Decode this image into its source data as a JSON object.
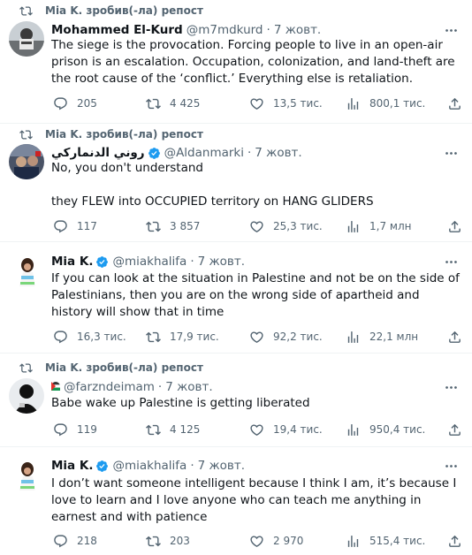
{
  "tweets": [
    {
      "repost": "Mia K. зробив(-ла) репост",
      "name": "Mohammed El-Kurd",
      "verified": false,
      "handle": "@m7mdkurd",
      "dot": "·",
      "date": "7 жовт.",
      "text": "The siege is the provocation. Forcing people to live in an open-air prison is an escalation. Occupation, colonization, and land-theft are the root cause of the ‘conflict.’ Everything else is retaliation.",
      "replies": "205",
      "reposts": "4 425",
      "likes": "13,5 тис.",
      "views": "800,1 тис."
    },
    {
      "repost": "Mia K. зробив(-ла) репост",
      "name": "روني الدنماركي",
      "verified": true,
      "handle": "@Aldanmarki",
      "dot": "·",
      "date": "7 жовт.",
      "text": "No, you don't understand\n\nthey FLEW into OCCUPIED territory on HANG GLIDERS",
      "replies": "117",
      "reposts": "3 857",
      "likes": "25,3 тис.",
      "views": "1,7 млн"
    },
    {
      "name": "Mia K.",
      "verified": true,
      "handle": "@miakhalifa",
      "dot": "·",
      "date": "7 жовт.",
      "text": "If you can look at the situation in Palestine and not be on the side of Palestinians, then you are on the wrong side of apartheid and history will show that in time",
      "replies": "16,3 тис.",
      "reposts": "17,9 тис.",
      "likes": "92,2 тис.",
      "views": "22,1 млн"
    },
    {
      "repost": "Mia K. зробив(-ла) репост",
      "name": "",
      "verified": false,
      "handle": "@farzndeimam",
      "dot": "·",
      "date": "7 жовт.",
      "text": "Babe wake up Palestine is getting liberated",
      "replies": "119",
      "reposts": "4 125",
      "likes": "19,4 тис.",
      "views": "950,4 тис."
    },
    {
      "name": "Mia K.",
      "verified": true,
      "handle": "@miakhalifa",
      "dot": "·",
      "date": "7 жовт.",
      "text": "I don’t want someone intelligent because I think I am, it’s because I love to learn and I love anyone who can teach me anything in earnest and with patience",
      "replies": "218",
      "reposts": "203",
      "likes": "2 970",
      "views": "515,4 тис."
    }
  ],
  "colors": {
    "text": "#0f1419",
    "muted": "#536471",
    "verified": "#1d9bf0",
    "divider": "#eff3f4"
  },
  "icons": [
    "repost-icon",
    "reply-icon",
    "like-icon",
    "views-icon",
    "share-icon",
    "more-icon",
    "verified-icon"
  ]
}
